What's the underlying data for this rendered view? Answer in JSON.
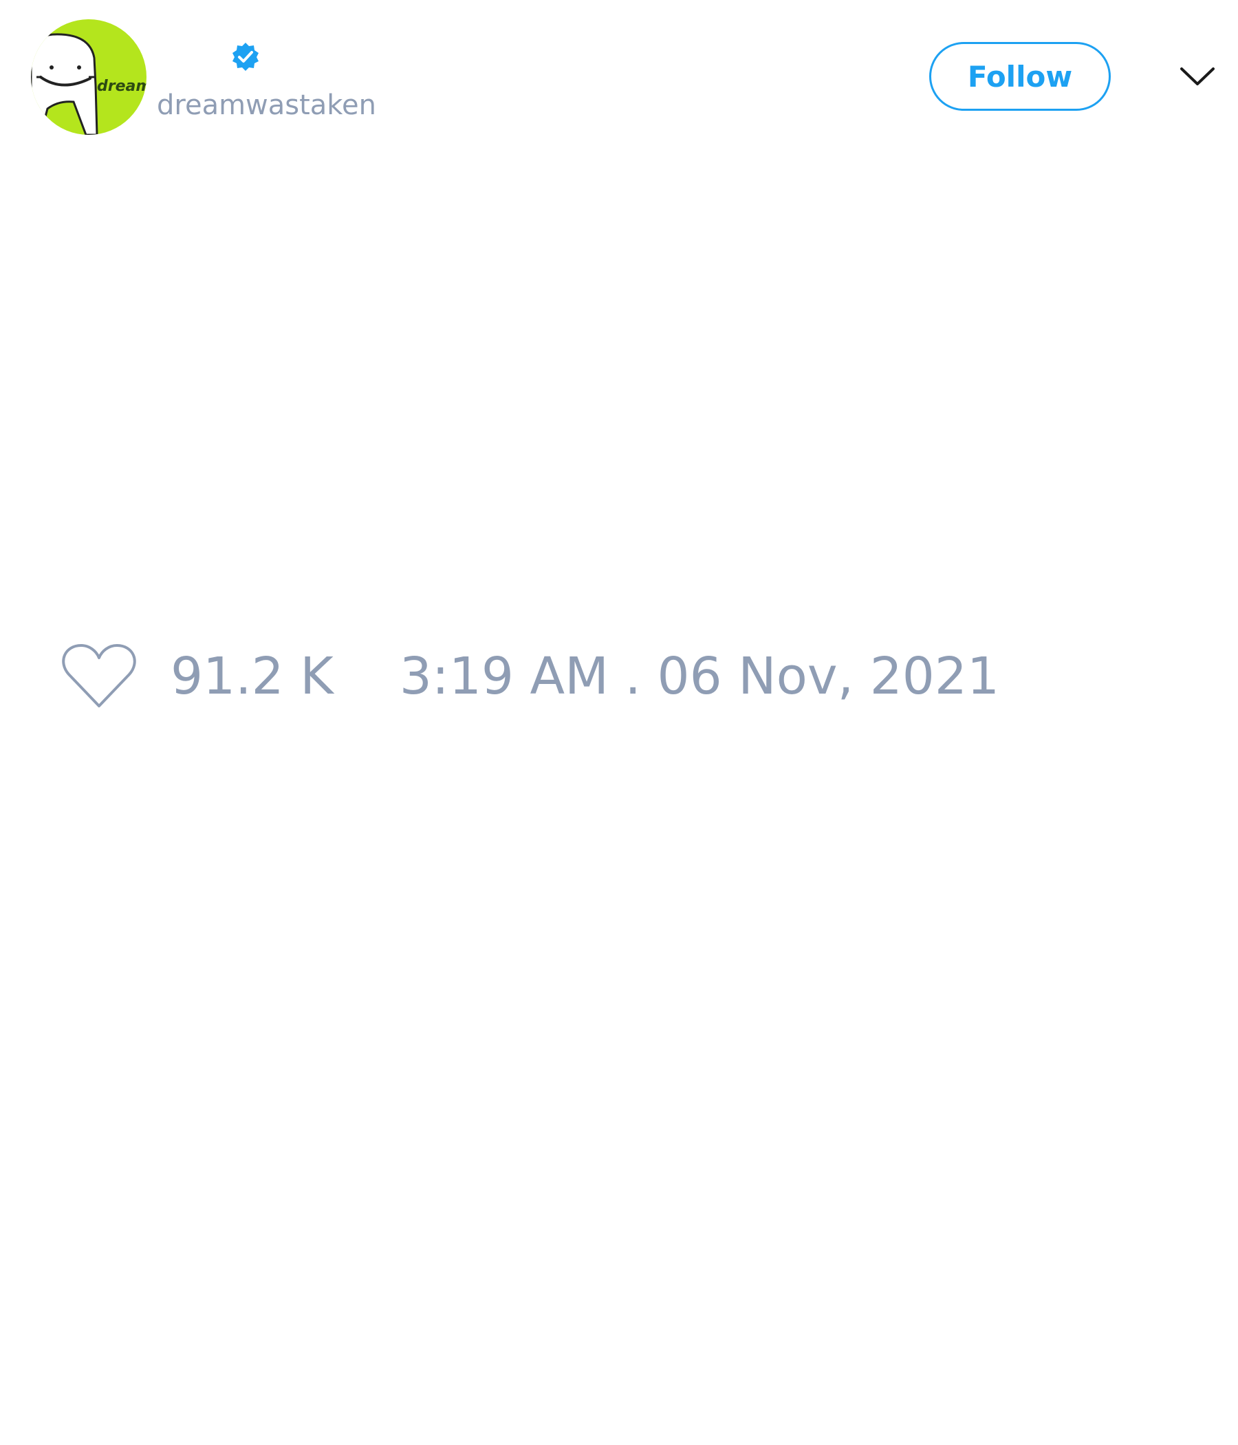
{
  "author": {
    "handle": "dreamwastaken",
    "avatar_text": "dream",
    "avatar_background": "#b4e51d",
    "verified": true
  },
  "header": {
    "follow_label": "Follow",
    "menu_icon": "chevron-down-icon"
  },
  "stats": {
    "likes_label": "91.2 K",
    "timestamp": "3:19 AM . 06 Nov, 2021"
  },
  "colors": {
    "accent": "#1da1f2",
    "muted_text": "#8f9db4"
  }
}
